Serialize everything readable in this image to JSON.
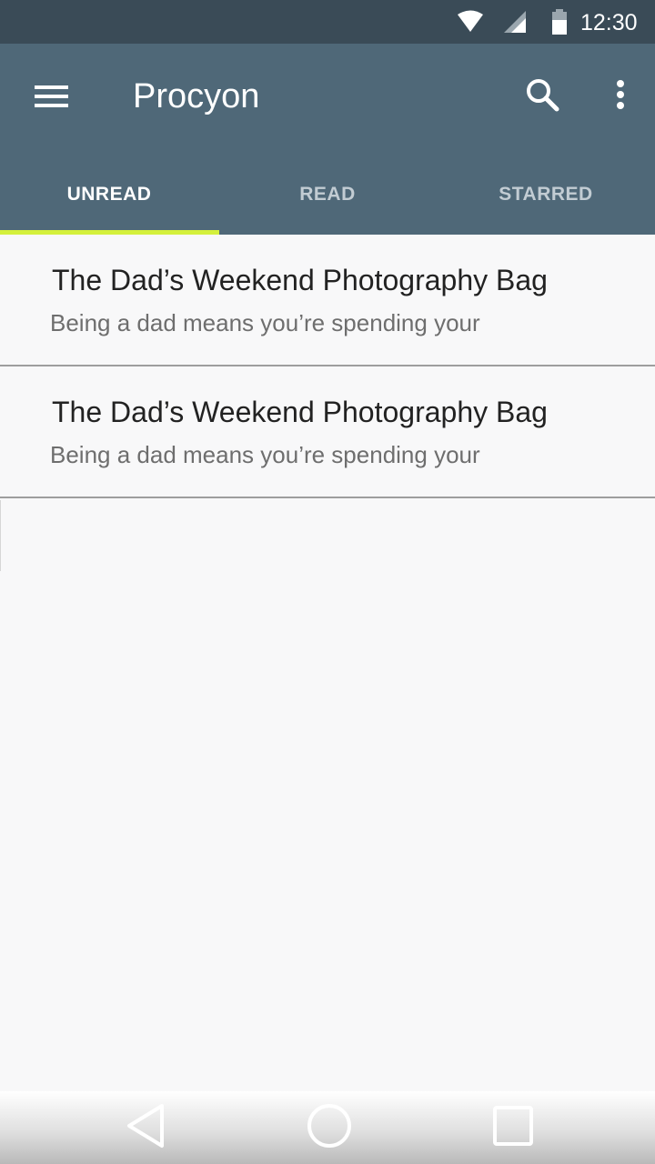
{
  "status_bar": {
    "time": "12:30",
    "icons": [
      "wifi-icon",
      "cell-signal-icon",
      "battery-icon"
    ]
  },
  "app_bar": {
    "title": "Procyon",
    "color": "#4f6878",
    "status_color": "#3a4b57",
    "icons": [
      "menu-icon",
      "search-icon",
      "more-vert-icon"
    ]
  },
  "tabs": [
    {
      "label": "UNREAD",
      "active": true
    },
    {
      "label": "READ",
      "active": false
    },
    {
      "label": "STARRED",
      "active": false
    }
  ],
  "accent_color": "#d4f03c",
  "articles": [
    {
      "title": "The Dad’s Weekend Photography Bag",
      "snippet": "Being a dad means you’re spending your"
    },
    {
      "title": "The Dad’s Weekend Photography Bag",
      "snippet": "Being a dad means you’re spending your"
    }
  ],
  "nav_bar": {
    "icons": [
      "back-icon",
      "home-icon",
      "recents-icon"
    ]
  }
}
